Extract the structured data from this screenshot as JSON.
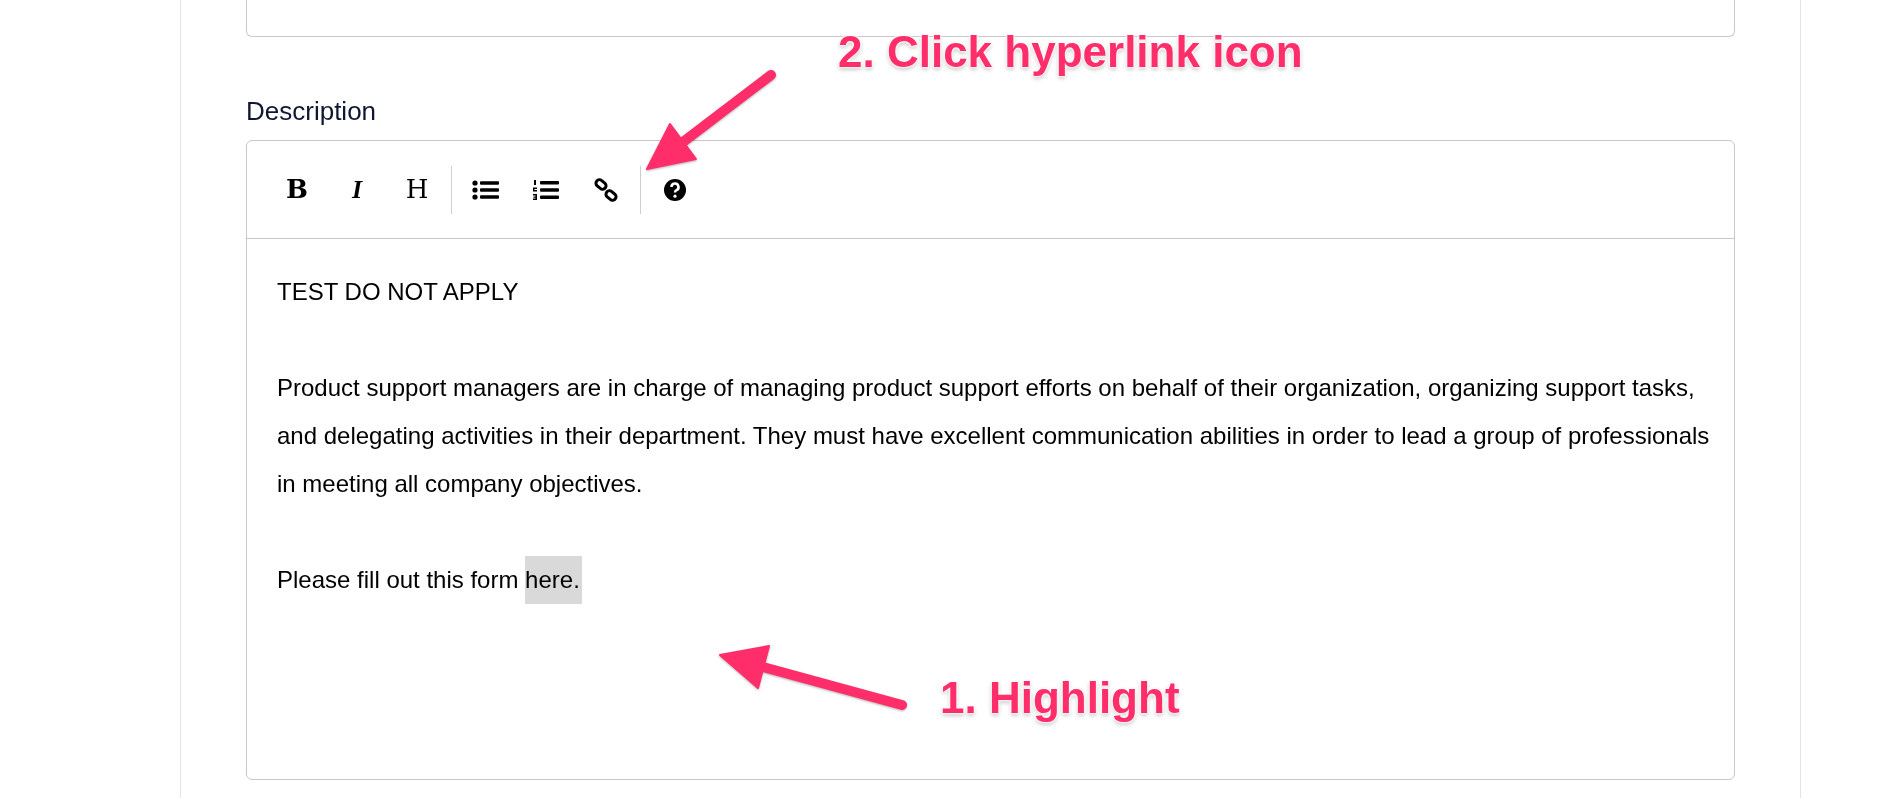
{
  "description_field": {
    "label": "Description",
    "toolbar": {
      "groups": [
        [
          {
            "kind": "bold",
            "label": "B"
          },
          {
            "kind": "italic",
            "label": "I"
          },
          {
            "kind": "heading",
            "label": "H"
          }
        ],
        [
          {
            "kind": "bullet-list"
          },
          {
            "kind": "numbered-list"
          },
          {
            "kind": "link"
          }
        ],
        [
          {
            "kind": "help"
          }
        ]
      ]
    },
    "paragraphs": [
      {
        "text": "TEST DO NOT APPLY"
      },
      {
        "text": "Product support managers are in charge of managing product support efforts on behalf of their organization, organizing support tasks, and delegating activities in their department. They must have excellent communication abilities in order to lead a group of professionals in meeting all company objectives."
      },
      {
        "text": "Please fill out this form ",
        "selection": "here."
      }
    ]
  },
  "annotations": [
    {
      "text": "2. Click hyperlink icon"
    },
    {
      "text": "1. Highlight"
    }
  ]
}
